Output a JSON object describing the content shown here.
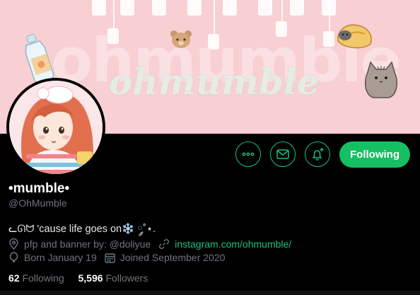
{
  "banner": {
    "title": "ohmumble",
    "overlay": "ohmumble"
  },
  "profile": {
    "display_name": "•mumble•",
    "handle": "@OhMumble",
    "bio": "ᓚᘏᗢ 'cause life goes on❄️ ༘˚⋆.",
    "credits": "pfp and banner by: @doliyue",
    "website": "instagram.com/ohmumble/",
    "born": "Born January 19",
    "joined": "Joined September 2020",
    "following_count": "62",
    "following_label": "Following",
    "followers_count": "5,596",
    "followers_label": "Followers"
  },
  "actions": {
    "more_icon": "more-icon",
    "message_icon": "mail-icon",
    "notify_icon": "bell-plus-icon",
    "follow_label": "Following"
  },
  "colors": {
    "accent": "#17bf63",
    "banner": "#f8cfd2",
    "muted": "#6e767d"
  }
}
